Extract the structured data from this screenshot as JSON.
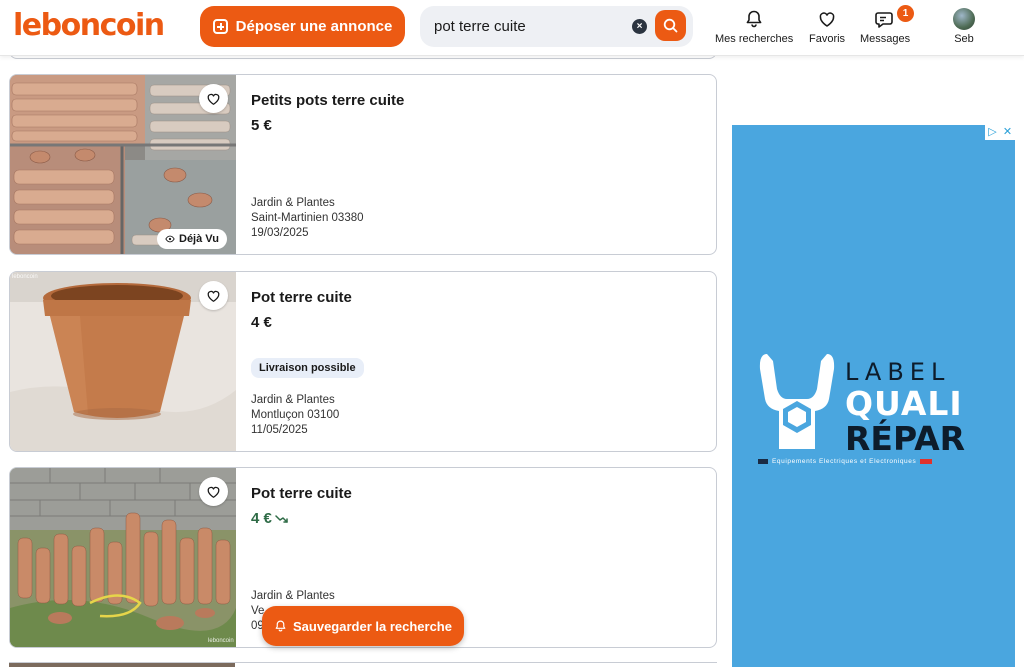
{
  "header": {
    "logo": "leboncoin",
    "post_button": "Déposer une annonce",
    "search_value": "pot terre cuite",
    "clear_icon": "×",
    "nav": [
      {
        "label": "Mes recherches",
        "icon": "bell-icon"
      },
      {
        "label": "Favoris",
        "icon": "heart-icon"
      },
      {
        "label": "Messages",
        "icon": "chat-icon",
        "badge": "1"
      },
      {
        "label": "Seb",
        "icon": "avatar"
      }
    ]
  },
  "listings": [
    {
      "title": "Petits pots terre cuite",
      "price": "5 €",
      "seen_label": "Déjà Vu",
      "category": "Jardin & Plantes",
      "location": "Saint-Martinien 03380",
      "date": "19/03/2025"
    },
    {
      "title": "Pot terre cuite",
      "price": "4 €",
      "delivery": "Livraison possible",
      "category": "Jardin & Plantes",
      "location": "Montluçon 03100",
      "date": "11/05/2025",
      "watermark": "leboncoin"
    },
    {
      "title": "Pot terre cuite",
      "price": "4 €",
      "price_icon": "price-drop-icon",
      "category": "Jardin & Plantes",
      "location": "Ve",
      "date": "09",
      "watermark": "leboncoin"
    }
  ],
  "save_search_button": "Sauvegarder la recherche",
  "ad": {
    "line1": "LABEL",
    "line2": "QUALI",
    "line3": "RÉPAR",
    "tagline": "Equipements Electriques et Electroniques",
    "controls": [
      "▷",
      "✕"
    ]
  },
  "colors": {
    "brand": "#ec5a13",
    "ad_background": "#4aa6df",
    "price_drop": "#2e6b46"
  }
}
